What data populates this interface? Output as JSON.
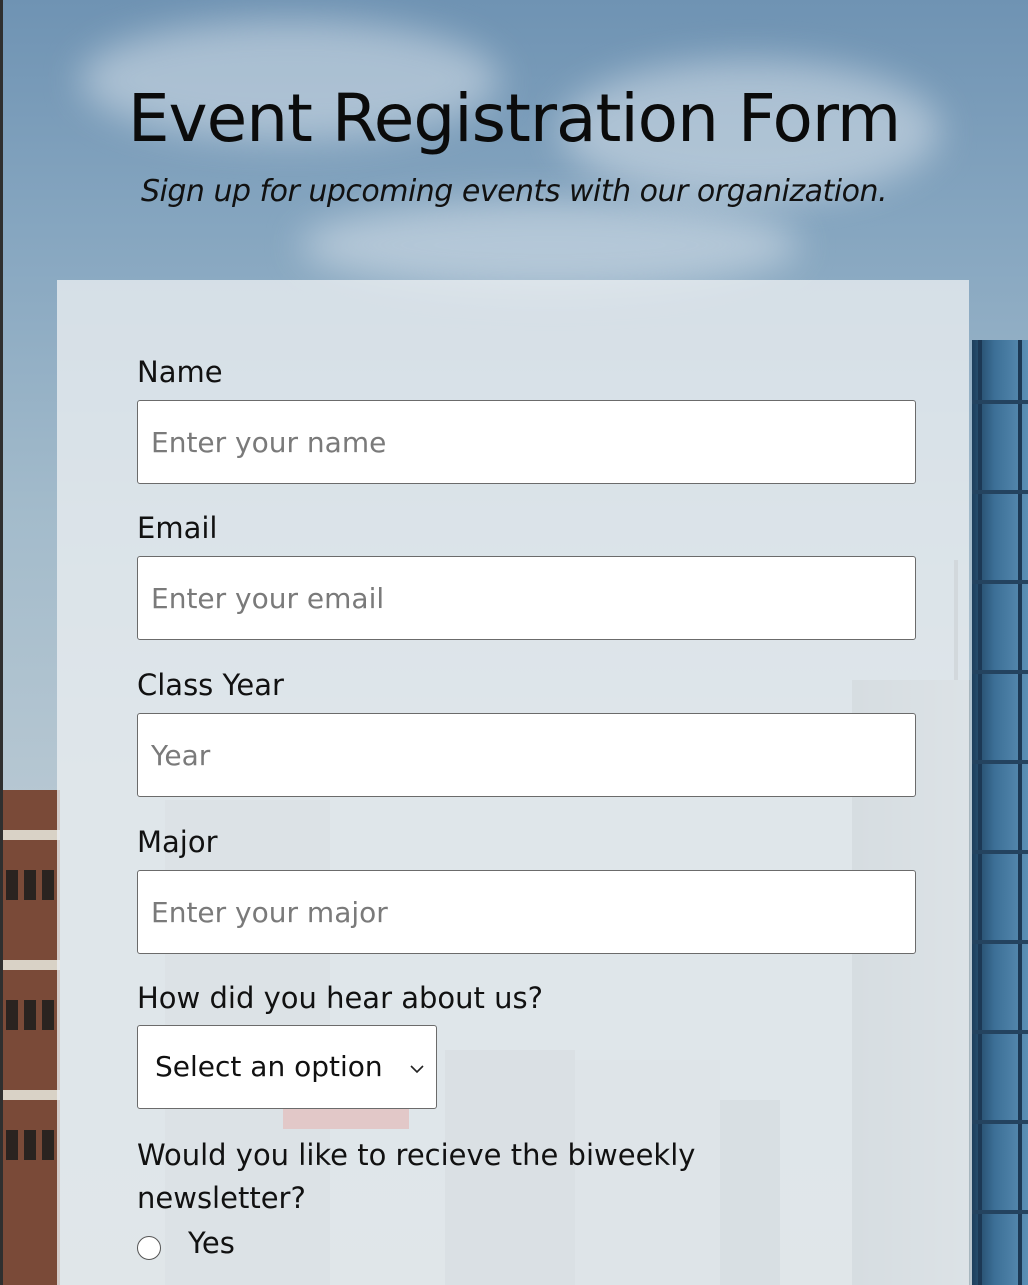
{
  "header": {
    "title": "Event Registration Form",
    "subtitle": "Sign up for upcoming events with our organization."
  },
  "form": {
    "name": {
      "label": "Name",
      "placeholder": "Enter your name",
      "value": ""
    },
    "email": {
      "label": "Email",
      "placeholder": "Enter your email",
      "value": ""
    },
    "class_year": {
      "label": "Class Year",
      "placeholder": "Year",
      "value": ""
    },
    "major": {
      "label": "Major",
      "placeholder": "Enter your major",
      "value": ""
    },
    "referral": {
      "label": "How did you hear about us?",
      "selected": "Select an option"
    },
    "newsletter": {
      "question": "Would you like to recieve the biweekly newsletter?",
      "options": [
        {
          "label": "Yes",
          "checked": false
        }
      ]
    }
  },
  "icons": {
    "select_chevron": "chevron-down-icon",
    "radio": "radio-unchecked-icon"
  },
  "colors": {
    "card_background": "#eaeef1",
    "field_border": "#6b6b6b",
    "placeholder": "#7a7a7a",
    "text": "#111111"
  }
}
